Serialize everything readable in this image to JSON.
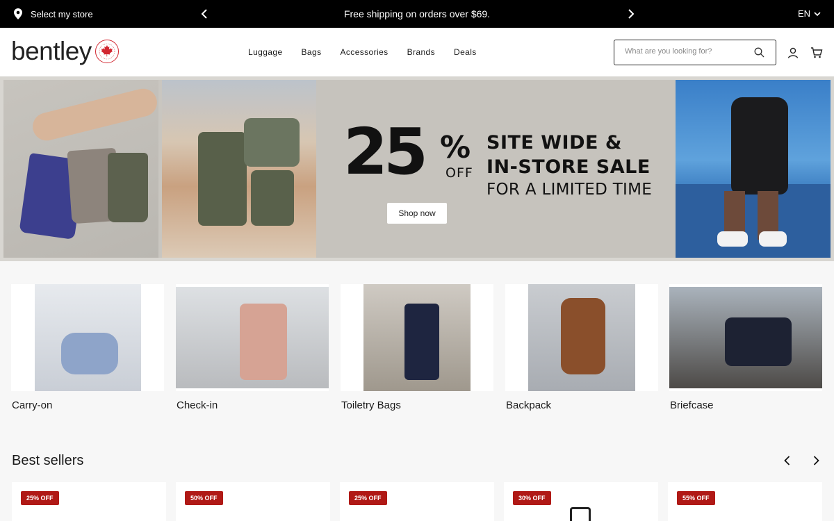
{
  "topbar": {
    "store_label": "Select my store",
    "promo": "Free shipping on orders over $69.",
    "language": "EN"
  },
  "header": {
    "logo": "bentley",
    "seal_text": "PROUDLY CANADIAN",
    "nav": [
      "Luggage",
      "Bags",
      "Accessories",
      "Brands",
      "Deals"
    ],
    "search_placeholder": "What are you looking for?"
  },
  "hero": {
    "percent": "25",
    "percent_sign": "%",
    "off": "OFF",
    "line1": "SITE WIDE &",
    "line2": "IN-STORE SALE",
    "line3": "FOR A LIMITED TIME",
    "cta": "Shop now"
  },
  "categories": [
    {
      "label": "Carry-on"
    },
    {
      "label": "Check-in"
    },
    {
      "label": "Toiletry Bags"
    },
    {
      "label": "Backpack"
    },
    {
      "label": "Briefcase"
    }
  ],
  "best_sellers": {
    "title": "Best sellers",
    "products": [
      {
        "badge": "25% OFF"
      },
      {
        "badge": "50% OFF"
      },
      {
        "badge": "25% OFF"
      },
      {
        "badge": "30% OFF"
      },
      {
        "badge": "55% OFF"
      }
    ]
  },
  "colors": {
    "topbar_bg": "#000000",
    "badge_red": "#b01916",
    "seal_red": "#d22630"
  }
}
